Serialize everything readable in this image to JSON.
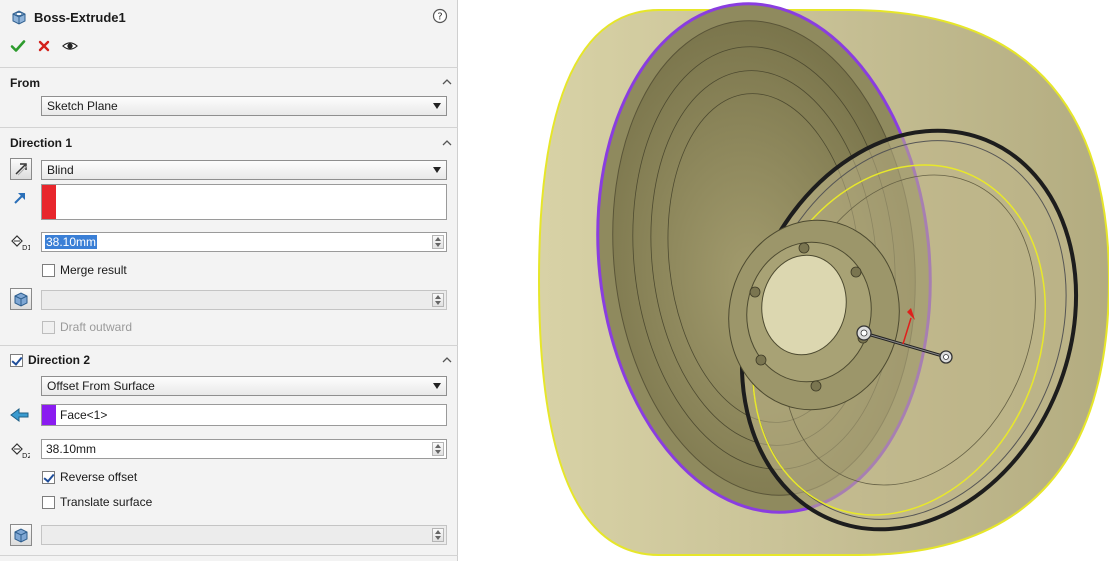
{
  "feature": {
    "title": "Boss-Extrude1",
    "help_icon": "help-icon",
    "actions": {
      "ok_icon": "check-icon",
      "cancel_icon": "close-icon",
      "preview_icon": "eye-icon"
    }
  },
  "from": {
    "header": "From",
    "start_condition": "Sketch Plane"
  },
  "direction1": {
    "header": "Direction 1",
    "end_condition": "Blind",
    "selection_color": "#e8262c",
    "depth_value": "38.10mm",
    "merge_result_label": "Merge result",
    "merge_result_checked": false,
    "draft_value": "",
    "draft_outward_label": "Draft outward",
    "draft_outward_checked": false
  },
  "direction2": {
    "header": "Direction 2",
    "enabled": true,
    "end_condition": "Offset From Surface",
    "face_selection": "Face<1>",
    "selection_color": "#8a1cf0",
    "offset_value": "38.10mm",
    "reverse_offset_label": "Reverse offset",
    "reverse_offset_checked": true,
    "translate_surface_label": "Translate surface",
    "translate_surface_checked": false,
    "draft_value": ""
  },
  "colors": {
    "panel_bg": "#f3f3f3",
    "model_body": "#bcb58a",
    "edge_highlight": "#e8e82a",
    "face_highlight": "#8a3de0",
    "arrow_red": "#e0201c"
  }
}
